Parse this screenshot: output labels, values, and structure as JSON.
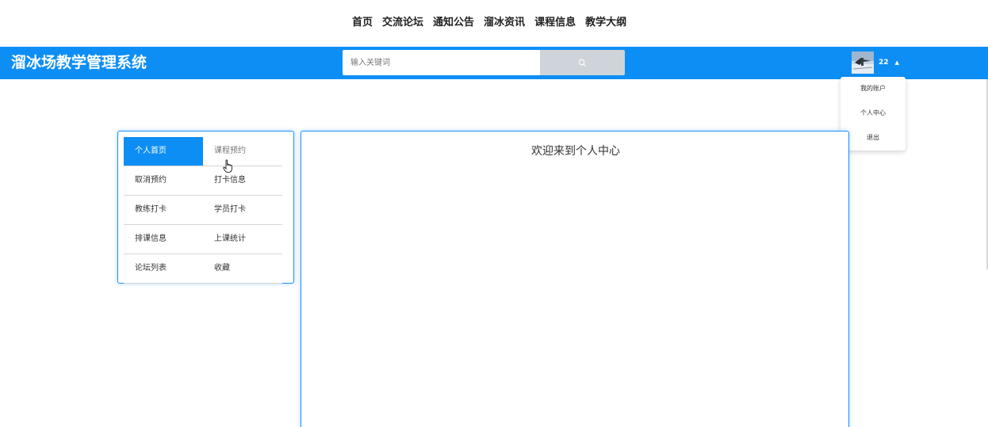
{
  "top_nav": {
    "items": [
      "首页",
      "交流论坛",
      "通知公告",
      "溜冰资讯",
      "课程信息",
      "教学大纲"
    ]
  },
  "header": {
    "brand": "溜冰场教学管理系统",
    "search_placeholder": "输入关键词",
    "search_icon": "search-icon",
    "user_name": "22",
    "caret_icon": "caret-up-icon",
    "accent_color": "#0d8ef5"
  },
  "user_menu": {
    "items": [
      "我的账户",
      "个人中心",
      "退出"
    ]
  },
  "sidebar": {
    "rows": [
      [
        "个人首页",
        "课程预约"
      ],
      [
        "取消预约",
        "打卡信息"
      ],
      [
        "教练打卡",
        "学员打卡"
      ],
      [
        "排课信息",
        "上课统计"
      ],
      [
        "论坛列表",
        "收藏"
      ]
    ],
    "active": "个人首页"
  },
  "main": {
    "title": "欢迎来到个人中心"
  }
}
